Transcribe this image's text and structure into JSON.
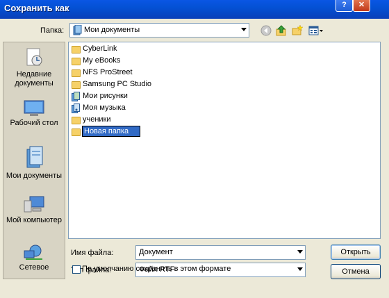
{
  "window": {
    "title": "Сохранить как",
    "help_label": "?",
    "close_label": "✕"
  },
  "location": {
    "label": "Папка:",
    "current": "Мои документы"
  },
  "places": [
    {
      "label": "Недавние документы"
    },
    {
      "label": "Рабочий стол"
    },
    {
      "label": "Мои документы"
    },
    {
      "label": "Мой компьютер"
    },
    {
      "label": "Сетевое"
    }
  ],
  "files": [
    {
      "name": "CyberLink",
      "icon": "folder-icon"
    },
    {
      "name": "My eBooks",
      "icon": "folder-icon"
    },
    {
      "name": "NFS ProStreet",
      "icon": "folder-icon"
    },
    {
      "name": "Samsung PC Studio",
      "icon": "folder-icon"
    },
    {
      "name": "Мои рисунки",
      "icon": "pictures-folder-icon"
    },
    {
      "name": "Моя музыка",
      "icon": "music-folder-icon"
    },
    {
      "name": "ученики",
      "icon": "folder-icon"
    },
    {
      "name": "Новая папка",
      "icon": "folder-icon",
      "editing": true
    }
  ],
  "filename": {
    "label": "Имя файла:",
    "value": "Документ"
  },
  "filetype": {
    "label": "Тип файла:",
    "value": "Файл RTF"
  },
  "buttons": {
    "open": "Открыть",
    "cancel": "Отмена"
  },
  "default_format": {
    "label": "По умолчанию сохранять в этом формате",
    "checked": false
  }
}
